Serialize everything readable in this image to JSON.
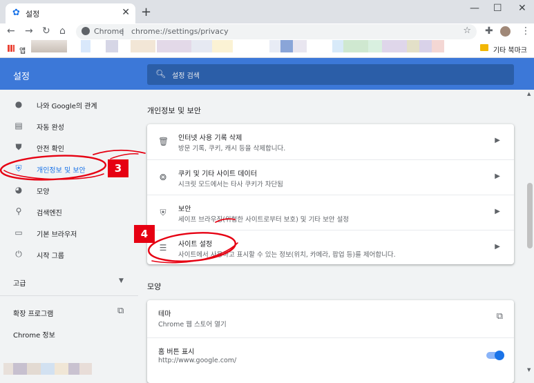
{
  "tab": {
    "title": "설정",
    "favicon": "gear-icon"
  },
  "omnibox": {
    "origin": "Chrome",
    "separator": "|",
    "url": "chrome://settings/privacy"
  },
  "bookmarks": {
    "apps_label": "앱",
    "other_label": "기타 북마크"
  },
  "header": {
    "title": "설정",
    "search_placeholder": "설정 검색"
  },
  "sidebar": {
    "items": [
      {
        "label": "나와 Google의 관계",
        "icon": "person-icon"
      },
      {
        "label": "자동 완성",
        "icon": "clipboard-icon"
      },
      {
        "label": "안전 확인",
        "icon": "shield-check-icon"
      },
      {
        "label": "개인정보 및 보안",
        "icon": "shield-icon",
        "active": true
      },
      {
        "label": "모양",
        "icon": "palette-icon"
      },
      {
        "label": "검색엔진",
        "icon": "search-icon"
      },
      {
        "label": "기본 브라우저",
        "icon": "browser-icon"
      },
      {
        "label": "시작 그룹",
        "icon": "power-icon"
      }
    ],
    "advanced_label": "고급",
    "extensions_label": "확장 프로그램",
    "about_label": "Chrome 정보"
  },
  "privacy": {
    "section_title": "개인정보 및 보안",
    "rows": [
      {
        "title": "인터넷 사용 기록 삭제",
        "desc": "방문 기록, 쿠키, 캐시 등을 삭제합니다.",
        "icon": "trash-icon"
      },
      {
        "title": "쿠키 및 기타 사이트 데이터",
        "desc": "시크릿 모드에서는 타사 쿠키가 차단됨",
        "icon": "cookie-icon"
      },
      {
        "title": "보안",
        "desc": "세이프 브라우징(위험한 사이트로부터 보호) 및 기타 보안 설정",
        "icon": "shield-icon"
      },
      {
        "title": "사이트 설정",
        "desc": "사이트에서 사용하고 표시할 수 있는 정보(위치, 카메라, 팝업 등)를 제어합니다.",
        "icon": "sliders-icon"
      }
    ]
  },
  "appearance": {
    "section_title": "모양",
    "theme_title": "테마",
    "theme_desc": "Chrome 웹 스토어 열기",
    "home_title": "홈 버튼 표시",
    "home_desc": "http://www.google.com/",
    "home_toggle_on": true
  },
  "annotations": {
    "step3": "3",
    "step4": "4",
    "color": "#e60012"
  }
}
